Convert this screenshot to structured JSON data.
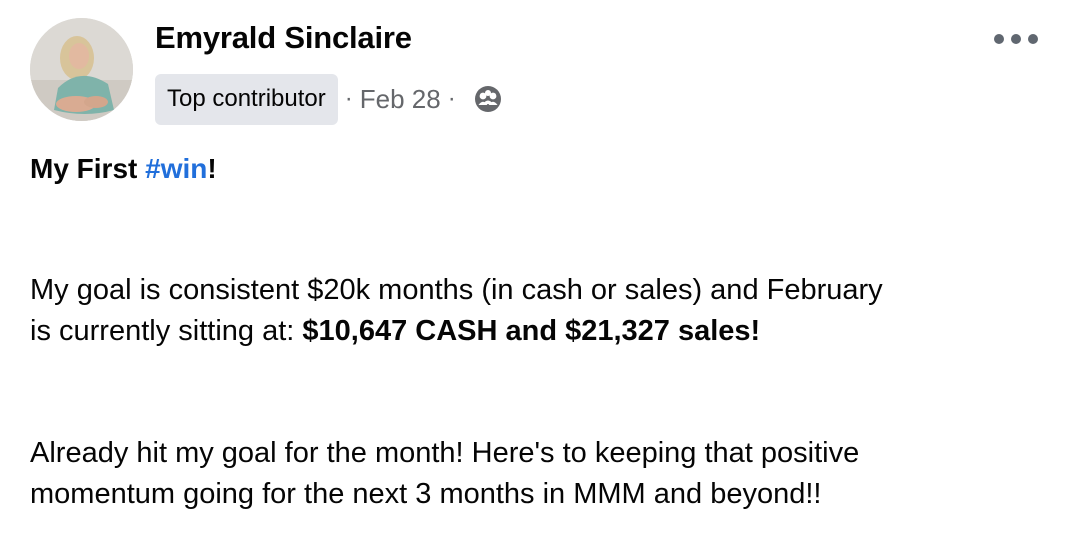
{
  "post": {
    "author": {
      "name": "Emyrald Sinclaire",
      "avatar_icon": "profile-photo"
    },
    "meta": {
      "badge": "Top contributor",
      "separator": "·",
      "date": "Feb 28",
      "audience_icon": "group-members-icon"
    },
    "menu_icon": "more-options-icon",
    "headline": {
      "prefix": "My First ",
      "hashtag": "#win",
      "suffix": "!"
    },
    "paragraph1": {
      "line1": "My goal is consistent $20k months (in cash or sales) and February",
      "line2_prefix": "is currently sitting at: ",
      "line2_bold": "$10,647 CASH and $21,327 sales!"
    },
    "paragraph2": {
      "line1": "Already hit my goal for the month! Here's to keeping that positive",
      "line2": "momentum going for the next 3 months in MMM and beyond!!"
    }
  },
  "colors": {
    "hashtag": "#216fdb",
    "text": "#050505",
    "secondary_text": "#65676b",
    "badge_bg": "#e4e6eb"
  }
}
